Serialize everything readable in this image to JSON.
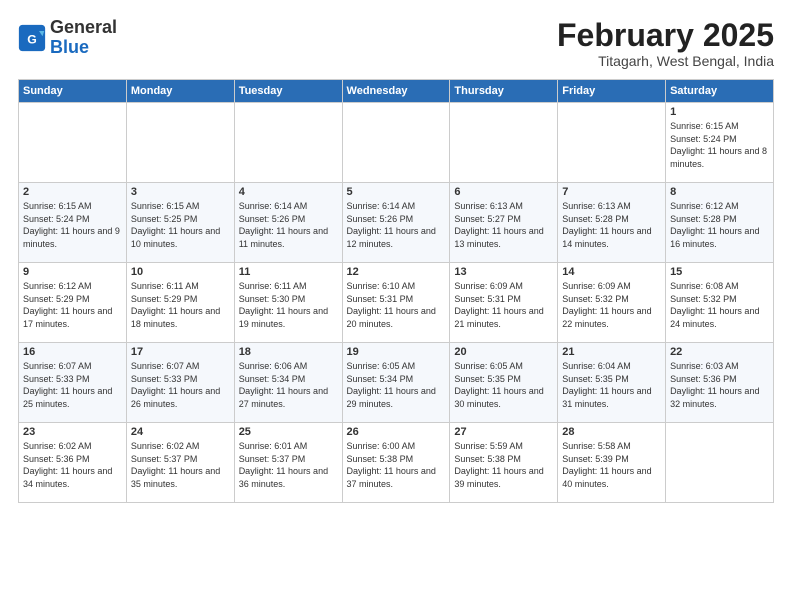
{
  "logo": {
    "general": "General",
    "blue": "Blue"
  },
  "title": "February 2025",
  "location": "Titagarh, West Bengal, India",
  "days_of_week": [
    "Sunday",
    "Monday",
    "Tuesday",
    "Wednesday",
    "Thursday",
    "Friday",
    "Saturday"
  ],
  "weeks": [
    [
      {
        "day": "",
        "info": ""
      },
      {
        "day": "",
        "info": ""
      },
      {
        "day": "",
        "info": ""
      },
      {
        "day": "",
        "info": ""
      },
      {
        "day": "",
        "info": ""
      },
      {
        "day": "",
        "info": ""
      },
      {
        "day": "1",
        "info": "Sunrise: 6:15 AM\nSunset: 5:24 PM\nDaylight: 11 hours and 8 minutes."
      }
    ],
    [
      {
        "day": "2",
        "info": "Sunrise: 6:15 AM\nSunset: 5:24 PM\nDaylight: 11 hours and 9 minutes."
      },
      {
        "day": "3",
        "info": "Sunrise: 6:15 AM\nSunset: 5:25 PM\nDaylight: 11 hours and 10 minutes."
      },
      {
        "day": "4",
        "info": "Sunrise: 6:14 AM\nSunset: 5:26 PM\nDaylight: 11 hours and 11 minutes."
      },
      {
        "day": "5",
        "info": "Sunrise: 6:14 AM\nSunset: 5:26 PM\nDaylight: 11 hours and 12 minutes."
      },
      {
        "day": "6",
        "info": "Sunrise: 6:13 AM\nSunset: 5:27 PM\nDaylight: 11 hours and 13 minutes."
      },
      {
        "day": "7",
        "info": "Sunrise: 6:13 AM\nSunset: 5:28 PM\nDaylight: 11 hours and 14 minutes."
      },
      {
        "day": "8",
        "info": "Sunrise: 6:12 AM\nSunset: 5:28 PM\nDaylight: 11 hours and 16 minutes."
      }
    ],
    [
      {
        "day": "9",
        "info": "Sunrise: 6:12 AM\nSunset: 5:29 PM\nDaylight: 11 hours and 17 minutes."
      },
      {
        "day": "10",
        "info": "Sunrise: 6:11 AM\nSunset: 5:29 PM\nDaylight: 11 hours and 18 minutes."
      },
      {
        "day": "11",
        "info": "Sunrise: 6:11 AM\nSunset: 5:30 PM\nDaylight: 11 hours and 19 minutes."
      },
      {
        "day": "12",
        "info": "Sunrise: 6:10 AM\nSunset: 5:31 PM\nDaylight: 11 hours and 20 minutes."
      },
      {
        "day": "13",
        "info": "Sunrise: 6:09 AM\nSunset: 5:31 PM\nDaylight: 11 hours and 21 minutes."
      },
      {
        "day": "14",
        "info": "Sunrise: 6:09 AM\nSunset: 5:32 PM\nDaylight: 11 hours and 22 minutes."
      },
      {
        "day": "15",
        "info": "Sunrise: 6:08 AM\nSunset: 5:32 PM\nDaylight: 11 hours and 24 minutes."
      }
    ],
    [
      {
        "day": "16",
        "info": "Sunrise: 6:07 AM\nSunset: 5:33 PM\nDaylight: 11 hours and 25 minutes."
      },
      {
        "day": "17",
        "info": "Sunrise: 6:07 AM\nSunset: 5:33 PM\nDaylight: 11 hours and 26 minutes."
      },
      {
        "day": "18",
        "info": "Sunrise: 6:06 AM\nSunset: 5:34 PM\nDaylight: 11 hours and 27 minutes."
      },
      {
        "day": "19",
        "info": "Sunrise: 6:05 AM\nSunset: 5:34 PM\nDaylight: 11 hours and 29 minutes."
      },
      {
        "day": "20",
        "info": "Sunrise: 6:05 AM\nSunset: 5:35 PM\nDaylight: 11 hours and 30 minutes."
      },
      {
        "day": "21",
        "info": "Sunrise: 6:04 AM\nSunset: 5:35 PM\nDaylight: 11 hours and 31 minutes."
      },
      {
        "day": "22",
        "info": "Sunrise: 6:03 AM\nSunset: 5:36 PM\nDaylight: 11 hours and 32 minutes."
      }
    ],
    [
      {
        "day": "23",
        "info": "Sunrise: 6:02 AM\nSunset: 5:36 PM\nDaylight: 11 hours and 34 minutes."
      },
      {
        "day": "24",
        "info": "Sunrise: 6:02 AM\nSunset: 5:37 PM\nDaylight: 11 hours and 35 minutes."
      },
      {
        "day": "25",
        "info": "Sunrise: 6:01 AM\nSunset: 5:37 PM\nDaylight: 11 hours and 36 minutes."
      },
      {
        "day": "26",
        "info": "Sunrise: 6:00 AM\nSunset: 5:38 PM\nDaylight: 11 hours and 37 minutes."
      },
      {
        "day": "27",
        "info": "Sunrise: 5:59 AM\nSunset: 5:38 PM\nDaylight: 11 hours and 39 minutes."
      },
      {
        "day": "28",
        "info": "Sunrise: 5:58 AM\nSunset: 5:39 PM\nDaylight: 11 hours and 40 minutes."
      },
      {
        "day": "",
        "info": ""
      }
    ]
  ]
}
